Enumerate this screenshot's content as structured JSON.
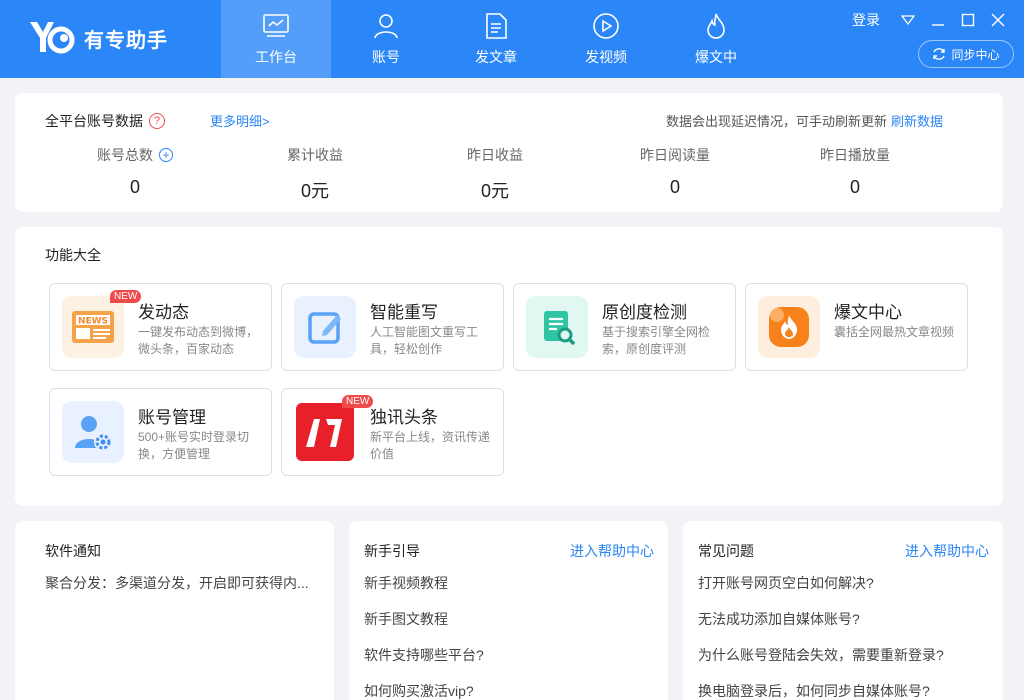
{
  "app": {
    "name": "有专助手",
    "logo_mark": "Yo"
  },
  "nav": [
    {
      "label": "工作台",
      "icon": "workbench-icon",
      "active": true
    },
    {
      "label": "账号",
      "icon": "user-icon",
      "active": false
    },
    {
      "label": "发文章",
      "icon": "document-icon",
      "active": false
    },
    {
      "label": "发视频",
      "icon": "play-icon",
      "active": false
    },
    {
      "label": "爆文中",
      "icon": "flame-icon",
      "active": false
    }
  ],
  "window": {
    "login_label": "登录",
    "sync_label": "同步中心"
  },
  "stats": {
    "title": "全平台账号数据",
    "more_link": "更多明细>",
    "delay_note": "数据会出现延迟情况，可手动刷新更新",
    "refresh_label": "刷新数据",
    "items": [
      {
        "label": "账号总数",
        "value": "0"
      },
      {
        "label": "累计收益",
        "value": "0元"
      },
      {
        "label": "昨日收益",
        "value": "0元"
      },
      {
        "label": "昨日阅读量",
        "value": "0"
      },
      {
        "label": "昨日播放量",
        "value": "0"
      }
    ]
  },
  "features": {
    "title": "功能大全",
    "badge_new": "NEW",
    "items": [
      {
        "title": "发动态",
        "desc": "一键发布动态到微博，微头条，百家动态",
        "icon": "news-icon",
        "is_new": true
      },
      {
        "title": "智能重写",
        "desc": "人工智能图文重写工具，轻松创作",
        "icon": "edit-icon",
        "is_new": false
      },
      {
        "title": "原创度检测",
        "desc": "基于搜索引擎全网检索，原创度评测",
        "icon": "doc-search-icon",
        "is_new": false
      },
      {
        "title": "爆文中心",
        "desc": "囊括全网最热文章视频",
        "icon": "fire-icon",
        "is_new": false
      },
      {
        "title": "账号管理",
        "desc": "500+账号实时登录切换，方便管理",
        "icon": "user-gear-icon",
        "is_new": false
      },
      {
        "title": "独讯头条",
        "desc": "新平台上线，资讯传递价值",
        "icon": "news-brand-icon",
        "is_new": true
      }
    ]
  },
  "notice": {
    "title": "软件通知",
    "items": [
      "聚合分发：多渠道分发，开启即可获得内..."
    ]
  },
  "guide": {
    "title": "新手引导",
    "link": "进入帮助中心",
    "items": [
      "新手视频教程",
      "新手图文教程",
      "软件支持哪些平台?",
      "如何购买激活vip?"
    ]
  },
  "faq": {
    "title": "常见问题",
    "link": "进入帮助中心",
    "items": [
      "打开账号网页空白如何解决?",
      "无法成功添加自媒体账号?",
      "为什么账号登陆会失效，需要重新登录?",
      "换电脑登录后，如何同步自媒体账号?"
    ]
  },
  "colors": {
    "primary": "#2b86f7",
    "nav_active": "#529ef9",
    "badge": "#f04b4b"
  }
}
